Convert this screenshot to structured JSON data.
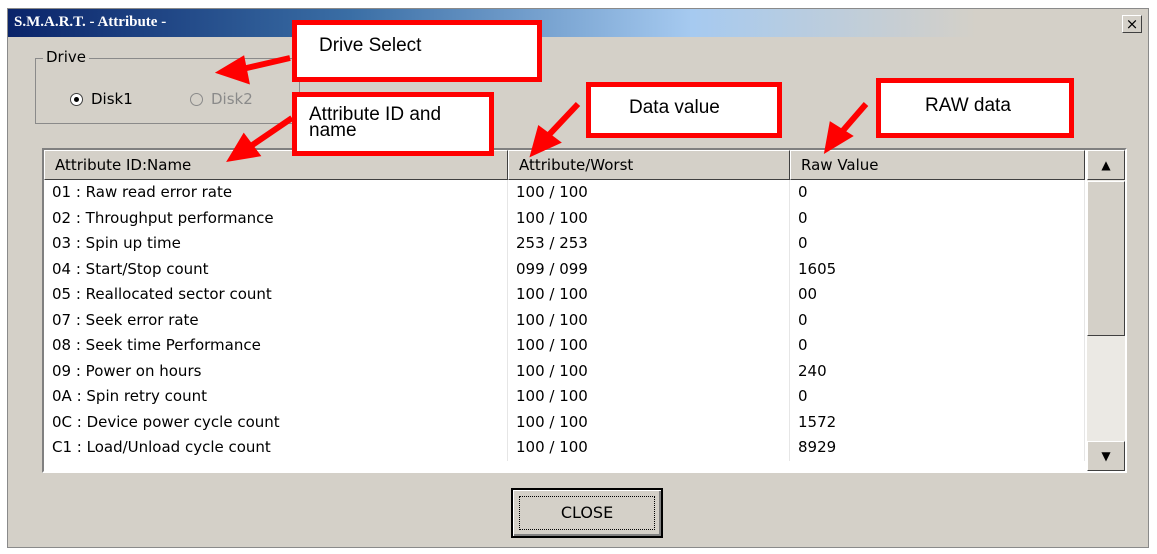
{
  "window": {
    "title": "S.M.A.R.T. - Attribute -",
    "close_glyph": "×"
  },
  "drive": {
    "legend": "Drive",
    "options": [
      {
        "label": "Disk1",
        "selected": true,
        "enabled": true
      },
      {
        "label": "Disk2",
        "selected": false,
        "enabled": false
      }
    ]
  },
  "table": {
    "headers": [
      "Attribute ID:Name",
      "Attribute/Worst",
      "Raw Value"
    ],
    "rows": [
      [
        "01 : Raw read error rate",
        "100 / 100",
        "0"
      ],
      [
        "02 : Throughput performance",
        "100 / 100",
        "0"
      ],
      [
        "03 : Spin up time",
        "253 / 253",
        "0"
      ],
      [
        "04 : Start/Stop count",
        "099 / 099",
        "1605"
      ],
      [
        "05 : Reallocated sector count",
        "100 / 100",
        "00"
      ],
      [
        "07 : Seek error rate",
        "100 / 100",
        "0"
      ],
      [
        "08 : Seek time Performance",
        "100 / 100",
        "0"
      ],
      [
        "09 : Power on hours",
        "100 / 100",
        "240"
      ],
      [
        "0A : Spin retry count",
        "100 / 100",
        "0"
      ],
      [
        "0C : Device power cycle count",
        "100 / 100",
        "1572"
      ],
      [
        "C1 : Load/Unload cycle count",
        "100 / 100",
        "8929"
      ]
    ],
    "scroll_up_glyph": "▲",
    "scroll_down_glyph": "▼"
  },
  "close_button": {
    "label": "CLOSE"
  },
  "annotations": {
    "drive_select": "Drive Select",
    "attribute_id_line1": "Attribute  ID and",
    "attribute_id_line2": "name",
    "data_value": "Data value",
    "raw_data": "RAW data",
    "color": "#ff0000"
  }
}
